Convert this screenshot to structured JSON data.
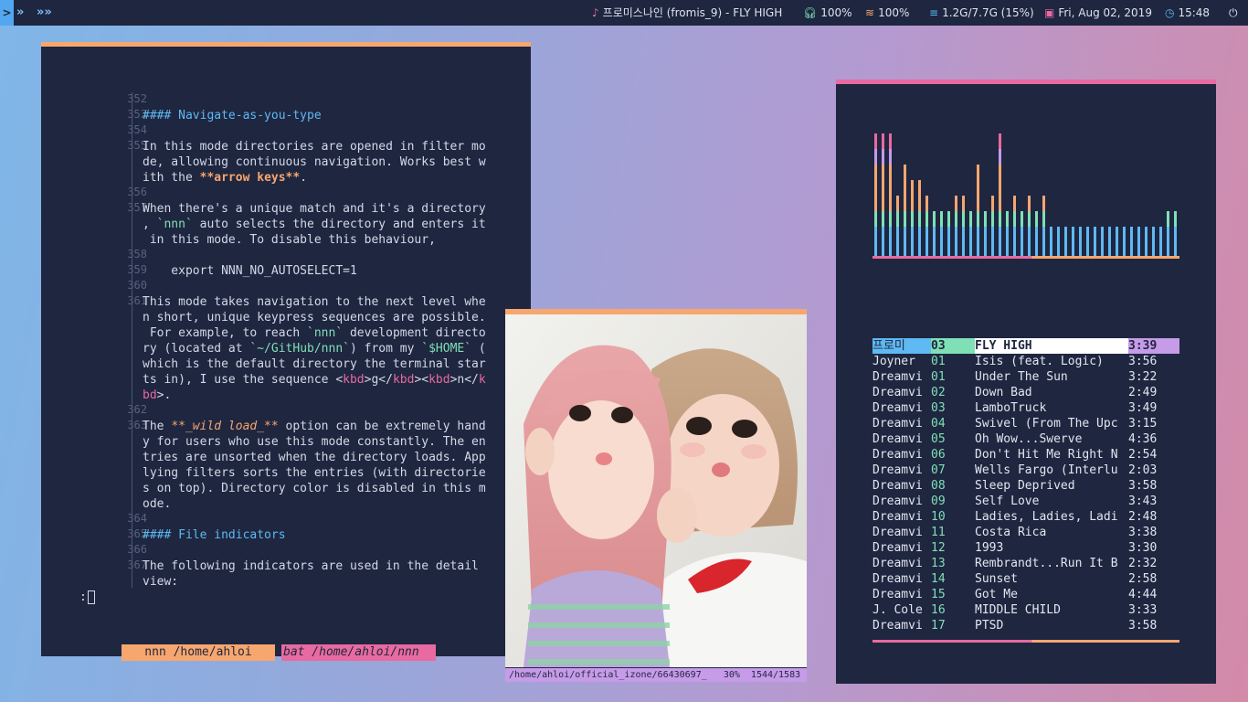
{
  "topbar": {
    "workspaces": [
      ">",
      "»",
      "»»"
    ],
    "music": "프로미스나인 (fromis_9) - FLY HIGH",
    "volume": "100%",
    "wifi": "100%",
    "memory": "1.2G/7.7G (15%)",
    "date": "Fri, Aug 02, 2019",
    "time": "15:48",
    "icons": [
      "music-note-icon",
      "headphones-icon",
      "wifi-icon",
      "memory-icon",
      "calendar-icon",
      "clock-icon",
      "power-icon"
    ]
  },
  "terminal": {
    "line_numbers": [
      "352",
      "353",
      "354",
      "355",
      "356",
      "357",
      "358",
      "359",
      "360",
      "361",
      "362",
      "363",
      "364",
      "365",
      "366",
      "367"
    ],
    "text": {
      "h1": "#### Navigate-as-you-type",
      "p1a": "In this mode directories are opened in filter mo",
      "p1b": "de, allowing continuous navigation. Works best w",
      "p1c_pre": "ith the ",
      "p1c_bold": "**arrow keys**",
      "p1c_post": ".",
      "p2a": "When there's a unique match and it's a directory",
      "p2b_pre": ", ",
      "p2b_code": "`nnn`",
      "p2b_post": " auto selects the directory and enters it",
      "p2c": " in this mode. To disable this behaviour,",
      "code1": "    export NNN_NO_AUTOSELECT=1",
      "p3a": "This mode takes navigation to the next level whe",
      "p3b": "n short, unique keypress sequences are possible.",
      "p3c_pre": " For example, to reach ",
      "p3c_code": "`nnn`",
      "p3c_post": " development directo",
      "p3d_pre": "ry (located at ",
      "p3d_code": "`~/GitHub/nnn`",
      "p3d_mid": ") from my ",
      "p3d_code2": "`$HOME`",
      "p3d_post": " (",
      "p3e": "which is the default directory the terminal star",
      "p3f_pre": "ts in), I use the sequence <",
      "p3f_t1": "kbd",
      "p3f_m1": ">g</",
      "p3f_t2": "kbd",
      "p3f_m2": "><",
      "p3f_t3": "kbd",
      "p3f_m3": ">n</",
      "p3f_t4": "k",
      "p3g_t": "bd",
      "p3g_post": ">.",
      "p4a_pre": "The ",
      "p4a_em": "**_wild load_**",
      "p4a_post": " option can be extremely hand",
      "p4b": "y for users who use this mode constantly. The en",
      "p4c": "tries are unsorted when the directory loads. App",
      "p4d": "lying filters sorts the entries (with directorie",
      "p4e": "s on top). Directory color is disabled in this m",
      "p4f": "ode.",
      "h2": "#### File indicators",
      "p5a": "The following indicators are used in the detail ",
      "p5b": "view:"
    },
    "prompt": ":",
    "tabs": [
      "nnn /home/ahloi",
      "bat /home/ahloi/nnn"
    ]
  },
  "viewer": {
    "status_path": "/home/ahloi/official_izone/66430697_",
    "status_zoom": "30%",
    "status_index": "1544/1583"
  },
  "music": {
    "visualizer_levels": [
      8,
      8,
      8,
      4,
      6,
      5,
      5,
      4,
      3,
      3,
      3,
      4,
      4,
      3,
      6,
      3,
      4,
      8,
      3,
      4,
      3,
      4,
      3,
      4,
      2,
      2,
      2,
      2,
      2,
      2,
      2,
      2,
      2,
      2,
      2,
      2,
      2,
      2,
      2,
      2,
      3,
      3
    ],
    "playlist": [
      {
        "artist": "프로미",
        "num": "03",
        "title": "FLY HIGH",
        "time": "3:39",
        "active": true
      },
      {
        "artist": "Joyner",
        "num": "01",
        "title": "Isis (feat. Logic)",
        "time": "3:56"
      },
      {
        "artist": "Dreamvi",
        "num": "01",
        "title": "Under The Sun",
        "time": "3:22"
      },
      {
        "artist": "Dreamvi",
        "num": "02",
        "title": "Down Bad",
        "time": "2:49"
      },
      {
        "artist": "Dreamvi",
        "num": "03",
        "title": "LamboTruck",
        "time": "3:49"
      },
      {
        "artist": "Dreamvi",
        "num": "04",
        "title": "Swivel (From The Upc",
        "time": "3:15"
      },
      {
        "artist": "Dreamvi",
        "num": "05",
        "title": "Oh Wow...Swerve",
        "time": "4:36"
      },
      {
        "artist": "Dreamvi",
        "num": "06",
        "title": "Don't Hit Me Right N",
        "time": "2:54"
      },
      {
        "artist": "Dreamvi",
        "num": "07",
        "title": "Wells Fargo (Interlu",
        "time": "2:03"
      },
      {
        "artist": "Dreamvi",
        "num": "08",
        "title": "Sleep Deprived",
        "time": "3:58"
      },
      {
        "artist": "Dreamvi",
        "num": "09",
        "title": "Self Love",
        "time": "3:43"
      },
      {
        "artist": "Dreamvi",
        "num": "10",
        "title": "Ladies, Ladies, Ladi",
        "time": "2:48"
      },
      {
        "artist": "Dreamvi",
        "num": "11",
        "title": "Costa Rica",
        "time": "3:38"
      },
      {
        "artist": "Dreamvi",
        "num": "12",
        "title": "1993",
        "time": "3:30"
      },
      {
        "artist": "Dreamvi",
        "num": "13",
        "title": "Rembrandt...Run It B",
        "time": "2:32"
      },
      {
        "artist": "Dreamvi",
        "num": "14",
        "title": "Sunset",
        "time": "2:58"
      },
      {
        "artist": "Dreamvi",
        "num": "15",
        "title": "Got Me",
        "time": "4:44"
      },
      {
        "artist": "J. Cole",
        "num": "16",
        "title": "MIDDLE CHILD",
        "time": "3:33"
      },
      {
        "artist": "Dreamvi",
        "num": "17",
        "title": "PTSD",
        "time": "3:58"
      }
    ]
  },
  "colors": {
    "bg_dark": "#1f2640",
    "accent_orange": "#f7a66e",
    "accent_pink": "#e86aa0",
    "accent_blue": "#5fb9f2",
    "accent_green": "#7fe0b6",
    "accent_purple": "#c69be8"
  }
}
